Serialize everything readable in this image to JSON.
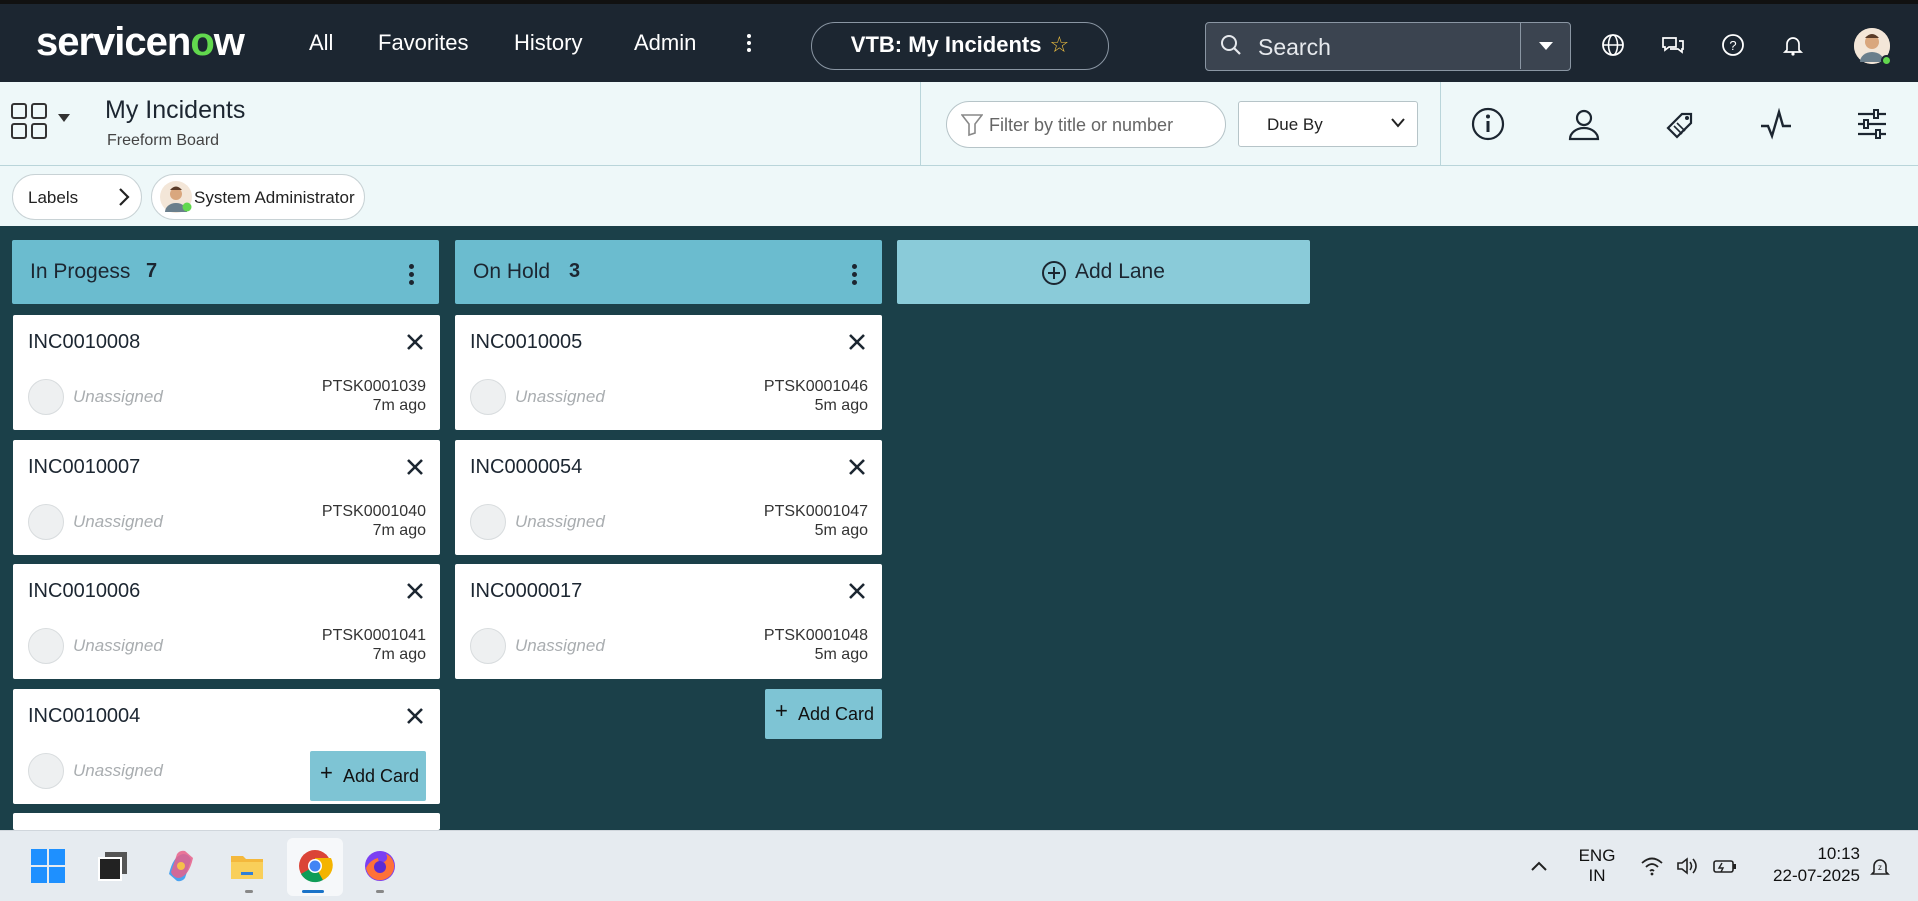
{
  "topbar": {
    "logo_text": "servicenow",
    "nav": [
      "All",
      "Favorites",
      "History",
      "Admin"
    ],
    "context_title": "VTB: My Incidents",
    "search_label": "Search"
  },
  "subheader": {
    "title": "My Incidents",
    "subtitle": "Freeform Board",
    "filter_placeholder": "Filter by title or number",
    "sort_selected": "Due By"
  },
  "chips": {
    "labels": "Labels",
    "user": "System Administrator"
  },
  "lanes": [
    {
      "name": "In Progess",
      "count": "7",
      "cards": [
        {
          "number": "INC0010008",
          "assignee": "Unassigned",
          "task": "PTSK0001039",
          "age": "7m ago"
        },
        {
          "number": "INC0010007",
          "assignee": "Unassigned",
          "task": "PTSK0001040",
          "age": "7m ago"
        },
        {
          "number": "INC0010006",
          "assignee": "Unassigned",
          "task": "PTSK0001041",
          "age": "7m ago"
        },
        {
          "number": "INC0010004",
          "assignee": "Unassigned",
          "task": "",
          "age": ""
        }
      ]
    },
    {
      "name": "On Hold",
      "count": "3",
      "cards": [
        {
          "number": "INC0010005",
          "assignee": "Unassigned",
          "task": "PTSK0001046",
          "age": "5m ago"
        },
        {
          "number": "INC0000054",
          "assignee": "Unassigned",
          "task": "PTSK0001047",
          "age": "5m ago"
        },
        {
          "number": "INC0000017",
          "assignee": "Unassigned",
          "task": "PTSK0001048",
          "age": "5m ago"
        }
      ]
    }
  ],
  "add_card_label": "Add Card",
  "add_lane_label": "Add Lane",
  "taskbar": {
    "lang_line1": "ENG",
    "lang_line2": "IN",
    "time": "10:13",
    "date": "22-07-2025"
  },
  "colors": {
    "topbar": "#1c2631",
    "board": "#1b4049",
    "lane_header": "#6bbccf",
    "add_lane": "#8acbd9",
    "accent_green": "#62d84e"
  }
}
